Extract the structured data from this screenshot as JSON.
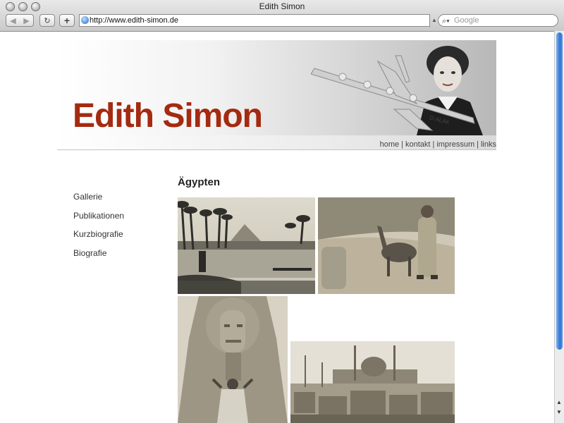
{
  "browser": {
    "window_title": "Edith Simon",
    "url": "http://www.edith-simon.de",
    "search_placeholder": "Google"
  },
  "site": {
    "title": "Edith Simon",
    "title_color": "#a42a10",
    "topnav": [
      "home",
      "kontakt",
      "impressum",
      "links"
    ],
    "topnav_separator": "|"
  },
  "sidebar": {
    "items": [
      "Gallerie",
      "Publikationen",
      "Kurzbiografie",
      "Biografie"
    ]
  },
  "main": {
    "section_title": "Ägypten"
  },
  "photos": [
    {
      "name": "nile-pyramids-photo"
    },
    {
      "name": "donkey-boy-photo"
    },
    {
      "name": "sphinx-photo"
    },
    {
      "name": "cairo-citadel-photo"
    }
  ]
}
